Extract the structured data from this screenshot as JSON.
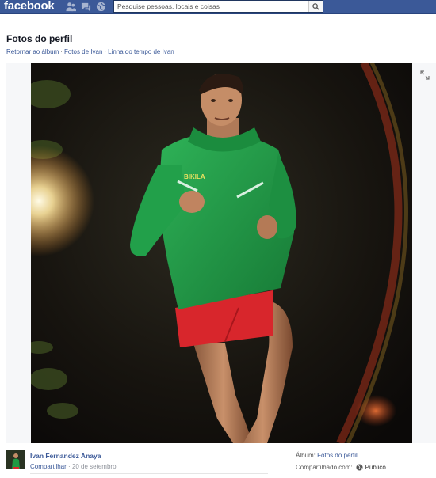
{
  "header": {
    "logo": "facebook",
    "search_placeholder": "Pesquise pessoas, locais e coisas",
    "jewels": [
      "friend-requests-icon",
      "messages-icon",
      "notifications-icon"
    ]
  },
  "page": {
    "title": "Fotos do perfil",
    "breadcrumbs": [
      "Retornar ao álbum",
      "Fotos de Ivan",
      "Linha do tempo de Ivan"
    ],
    "separator": "·"
  },
  "post": {
    "author": "Ivan Fernandez Anaya",
    "share_label": "Compartilhar",
    "meta_separator": "·",
    "date": "20 de setembro",
    "album_label": "Álbum:",
    "album_value": "Fotos do perfil",
    "shared_label": "Compartilhado com:",
    "shared_value": "Público"
  },
  "photo": {
    "jacket_brand": "BIKILA"
  },
  "colors": {
    "brand": "#3b5998",
    "link": "#3b5998",
    "jacket": "#1f9a43",
    "shorts": "#d8262c"
  }
}
